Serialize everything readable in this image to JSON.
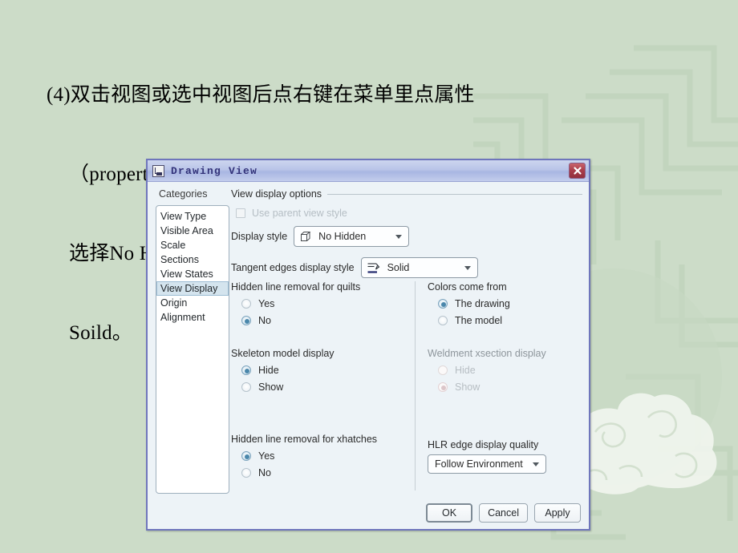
{
  "slide": {
    "lines": [
      "(4)双击视图或选中视图后点右键在菜单里点属性",
      "（properties），在按下图设置，在Didplay style里面",
      "选择No Hidden，在Tangent edges display style里面选",
      "Soild。"
    ]
  },
  "dialog": {
    "title": "Drawing View",
    "title_icon": "drawing-view-icon",
    "close_icon": "close-icon",
    "categories": {
      "label": "Categories",
      "items": [
        "View Type",
        "Visible Area",
        "Scale",
        "Sections",
        "View States",
        "View Display",
        "Origin",
        "Alignment"
      ],
      "selected": "View Display"
    },
    "options": {
      "group_title": "View display options",
      "use_parent": {
        "label": "Use parent view style",
        "checked": false,
        "disabled": true
      },
      "display_style": {
        "label": "Display style",
        "value": "No Hidden",
        "icon": "cube-icon"
      },
      "tangent_edges": {
        "label": "Tangent edges display style",
        "value": "Solid",
        "icon": "tangent-edge-icon"
      },
      "quilts": {
        "title": "Hidden line removal for quilts",
        "options": [
          "Yes",
          "No"
        ],
        "selected": "No"
      },
      "skeleton": {
        "title": "Skeleton model display",
        "options": [
          "Hide",
          "Show"
        ],
        "selected": "Hide"
      },
      "xhatches": {
        "title": "Hidden line removal for xhatches",
        "options": [
          "Yes",
          "No"
        ],
        "selected": "Yes"
      },
      "colors": {
        "title": "Colors come from",
        "options": [
          "The drawing",
          "The model"
        ],
        "selected": "The drawing"
      },
      "weldment": {
        "title": "Weldment xsection display",
        "options": [
          "Hide",
          "Show"
        ],
        "selected": "Show",
        "disabled": true
      },
      "hlr": {
        "title": "HLR edge display quality",
        "value": "Follow Environment"
      }
    },
    "footer": {
      "ok": "OK",
      "cancel": "Cancel",
      "apply": "Apply"
    }
  },
  "colors": {
    "slide_background": "#ccdcc8",
    "dialog_border": "#6f76bc",
    "dialog_background": "#edf3f7",
    "titlebar_text": "#33337a",
    "close_button": "#a83c49",
    "selection": "#d4e4ee",
    "radio_dot": "#4a87ab"
  }
}
